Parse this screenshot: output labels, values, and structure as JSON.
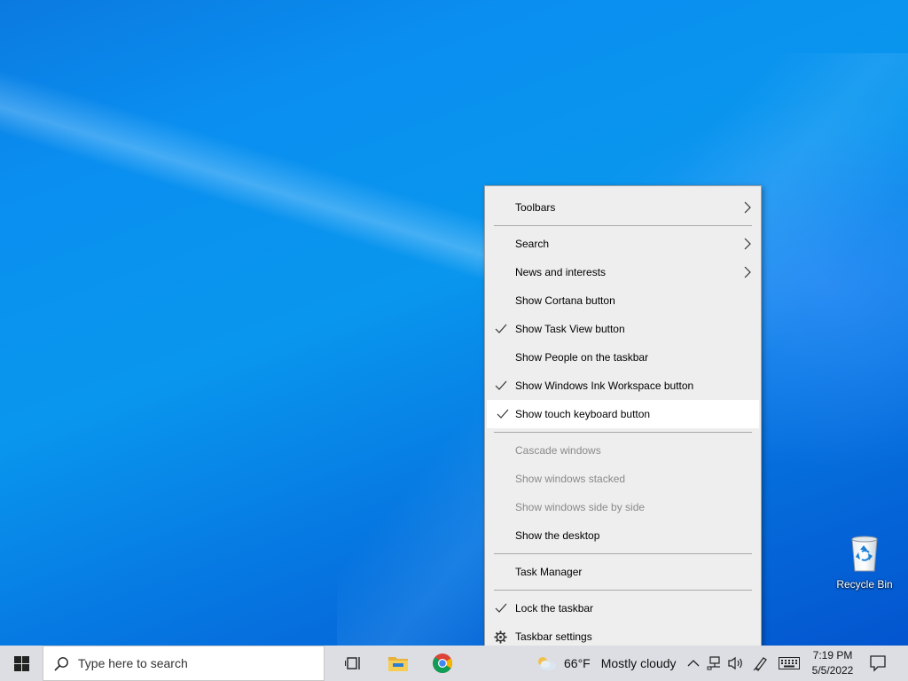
{
  "desktop": {
    "icons": [
      {
        "label": "Recycle Bin",
        "icon": "recycle-bin-icon"
      }
    ]
  },
  "context_menu": {
    "items": [
      {
        "label": "Toolbars",
        "checked": false,
        "submenu": true,
        "disabled": false,
        "hovered": false
      },
      {
        "separator": true
      },
      {
        "label": "Search",
        "checked": false,
        "submenu": true,
        "disabled": false,
        "hovered": false
      },
      {
        "label": "News and interests",
        "checked": false,
        "submenu": true,
        "disabled": false,
        "hovered": false
      },
      {
        "label": "Show Cortana button",
        "checked": false,
        "submenu": false,
        "disabled": false,
        "hovered": false
      },
      {
        "label": "Show Task View button",
        "checked": true,
        "submenu": false,
        "disabled": false,
        "hovered": false
      },
      {
        "label": "Show People on the taskbar",
        "checked": false,
        "submenu": false,
        "disabled": false,
        "hovered": false
      },
      {
        "label": "Show Windows Ink Workspace button",
        "checked": true,
        "submenu": false,
        "disabled": false,
        "hovered": false
      },
      {
        "label": "Show touch keyboard button",
        "checked": true,
        "submenu": false,
        "disabled": false,
        "hovered": true
      },
      {
        "separator": true
      },
      {
        "label": "Cascade windows",
        "checked": false,
        "submenu": false,
        "disabled": true,
        "hovered": false
      },
      {
        "label": "Show windows stacked",
        "checked": false,
        "submenu": false,
        "disabled": true,
        "hovered": false
      },
      {
        "label": "Show windows side by side",
        "checked": false,
        "submenu": false,
        "disabled": true,
        "hovered": false
      },
      {
        "label": "Show the desktop",
        "checked": false,
        "submenu": false,
        "disabled": false,
        "hovered": false
      },
      {
        "separator": true
      },
      {
        "label": "Task Manager",
        "checked": false,
        "submenu": false,
        "disabled": false,
        "hovered": false
      },
      {
        "separator": true
      },
      {
        "label": "Lock the taskbar",
        "checked": true,
        "submenu": false,
        "disabled": false,
        "hovered": false
      },
      {
        "label": "Taskbar settings",
        "checked": false,
        "submenu": false,
        "disabled": false,
        "hovered": false,
        "icon": "gear-icon"
      }
    ]
  },
  "taskbar": {
    "start_icon": "windows-logo-icon",
    "search_placeholder": "Type here to search",
    "pinned": [
      {
        "name": "task-view",
        "icon": "task-view-icon"
      },
      {
        "name": "file-explorer",
        "icon": "folder-icon"
      },
      {
        "name": "chrome",
        "icon": "chrome-icon"
      }
    ],
    "weather": {
      "icon": "partly-cloudy-icon",
      "temperature": "66°F",
      "condition": "Mostly cloudy"
    },
    "tray_icons": [
      "chevron-up-icon",
      "network-icon",
      "volume-icon",
      "pen-icon",
      "keyboard-icon"
    ],
    "clock": {
      "time": "7:19 PM",
      "date": "5/5/2022"
    },
    "notification_icon": "notification-icon"
  },
  "colors": {
    "desktop_blue": "#0996ee",
    "taskbar_bg": "#dcdee3",
    "menu_bg": "#eeeeee",
    "menu_hover": "#ffffff",
    "disabled_text": "#8a8a8a"
  }
}
